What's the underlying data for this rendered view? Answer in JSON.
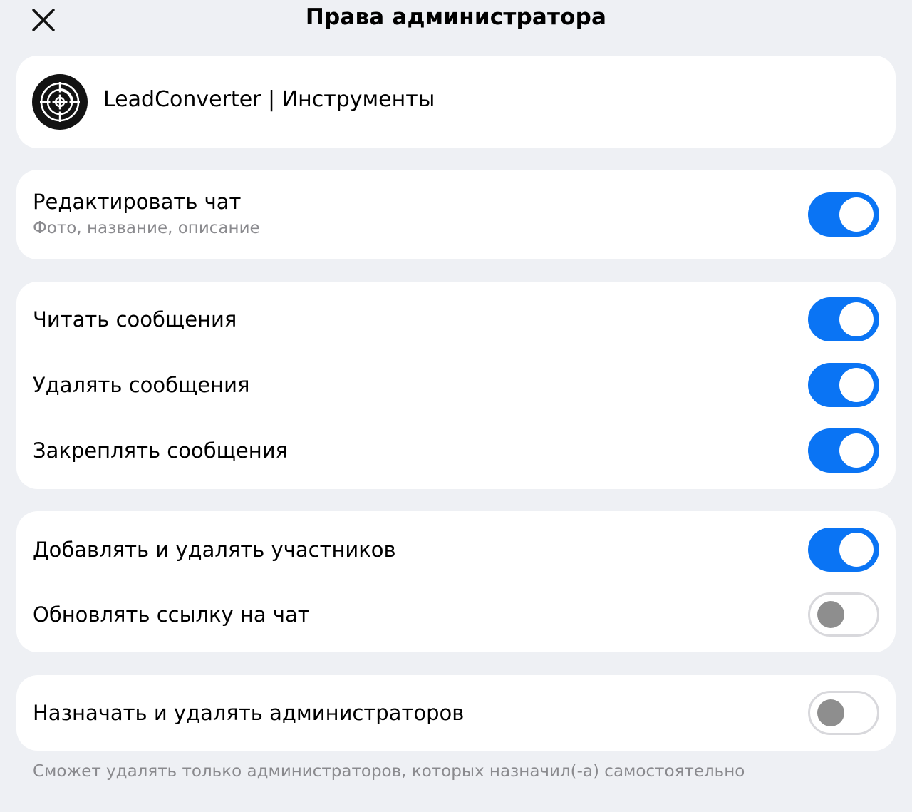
{
  "header": {
    "title": "Права администратора",
    "close_icon": "close-icon"
  },
  "channel": {
    "name": "LeadConverter | Инструменты",
    "avatar_icon": "target-logo-icon"
  },
  "permissions": {
    "edit_chat": {
      "label": "Редактировать чат",
      "sublabel": "Фото, название, описание",
      "enabled": true
    },
    "read_messages": {
      "label": "Читать сообщения",
      "enabled": true
    },
    "delete_messages": {
      "label": "Удалять сообщения",
      "enabled": true
    },
    "pin_messages": {
      "label": "Закреплять сообщения",
      "enabled": true
    },
    "manage_members": {
      "label": "Добавлять и удалять участников",
      "enabled": true
    },
    "update_link": {
      "label": "Обновлять ссылку на чат",
      "enabled": false
    },
    "manage_admins": {
      "label": "Назначать и удалять администраторов",
      "enabled": false
    }
  },
  "footnote": "Сможет удалять только администраторов, которых назначил(-а) самостоятельно",
  "colors": {
    "background": "#eef0f4",
    "card": "#ffffff",
    "toggle_on": "#0a74f4",
    "toggle_off_knob": "#8e8e8e",
    "secondary_text": "#8a8a8e"
  }
}
